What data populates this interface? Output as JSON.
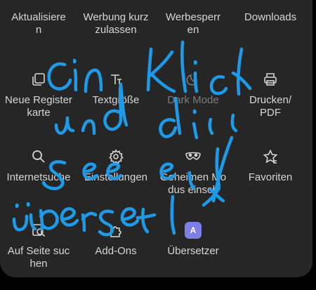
{
  "menu": {
    "items": [
      {
        "label": "Aktualisiere\nn",
        "icon": "refresh-icon"
      },
      {
        "label": "Werbung kurz zulassen",
        "icon": "ad-icon"
      },
      {
        "label": "Werbesperr\nen",
        "icon": "block-icon"
      },
      {
        "label": "Downloads",
        "icon": "download-icon"
      },
      {
        "label": "Neue Registerkarte",
        "icon": "new-tab-icon"
      },
      {
        "label": "Textgröße",
        "icon": "text-size-icon"
      },
      {
        "label": "Dark Mode",
        "icon": "dark-mode-icon"
      },
      {
        "label": "Drucken/\nPDF",
        "icon": "print-icon"
      },
      {
        "label": "Internetsuche",
        "icon": "search-icon"
      },
      {
        "label": "Einstellungen",
        "icon": "gear-icon"
      },
      {
        "label": "Geheimen Modus einsch",
        "icon": "mask-icon"
      },
      {
        "label": "Favoriten",
        "icon": "star-icon"
      },
      {
        "label": "Auf Seite suchen",
        "icon": "find-in-page-icon"
      },
      {
        "label": "Add-Ons",
        "icon": "addons-icon"
      },
      {
        "label": "Übersetzer",
        "icon": "translator-icon"
      }
    ],
    "translator_badge": "A"
  },
  "colors": {
    "panel": "#262626",
    "text": "#d6d6d6",
    "disabled_text": "#7c7c7c",
    "scribble": "#1e9be8",
    "translator_accent": "#7b7fe6"
  }
}
